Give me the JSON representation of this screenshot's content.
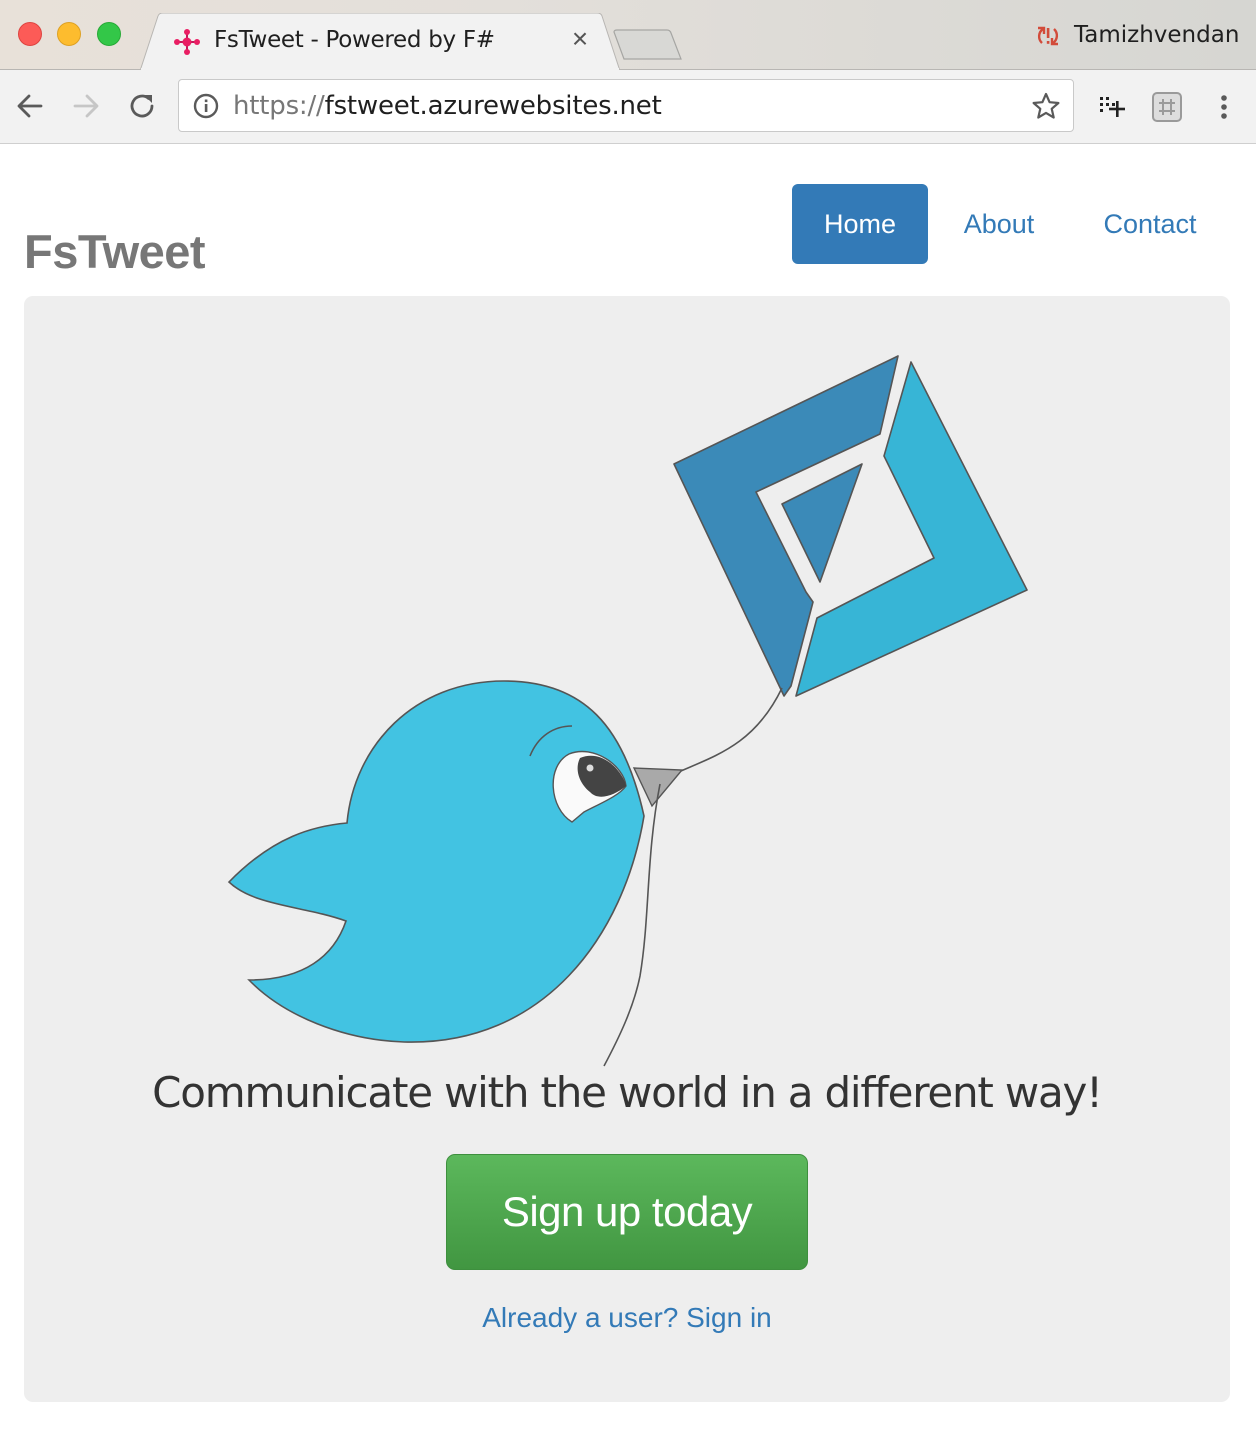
{
  "browser": {
    "tab": {
      "title": "FsTweet - Powered by F#",
      "favicon": "fsharp-logo-icon",
      "close": "×"
    },
    "profile": {
      "name": "Tamizhvendan",
      "icon": "sync-error-icon"
    },
    "toolbar": {
      "back": "back-arrow-icon",
      "forward": "forward-arrow-icon",
      "reload": "reload-icon",
      "url_scheme": "https://",
      "url_host": "fstweet.azurewebsites.net",
      "info": "info-icon",
      "bookmark": "star-icon",
      "extensions": [
        "extension-grid-icon",
        "extension-hash-icon"
      ],
      "menu": "kebab-menu-icon"
    }
  },
  "page": {
    "brand": "FsTweet",
    "nav": [
      {
        "label": "Home",
        "active": true
      },
      {
        "label": "About",
        "active": false
      },
      {
        "label": "Contact",
        "active": false
      }
    ],
    "hero": {
      "tagline": "Communicate with the world in a different way!",
      "signup_label": "Sign up today",
      "signin_label": "Already a user? Sign in"
    }
  },
  "colors": {
    "primary": "#337ab7",
    "success": "#5cb85c",
    "jumbotron_bg": "#eeeeee",
    "bird_blue": "#42c3e2",
    "kite_dark": "#3b8ab8",
    "kite_light": "#37b5d6",
    "brand_gray": "#777777"
  }
}
